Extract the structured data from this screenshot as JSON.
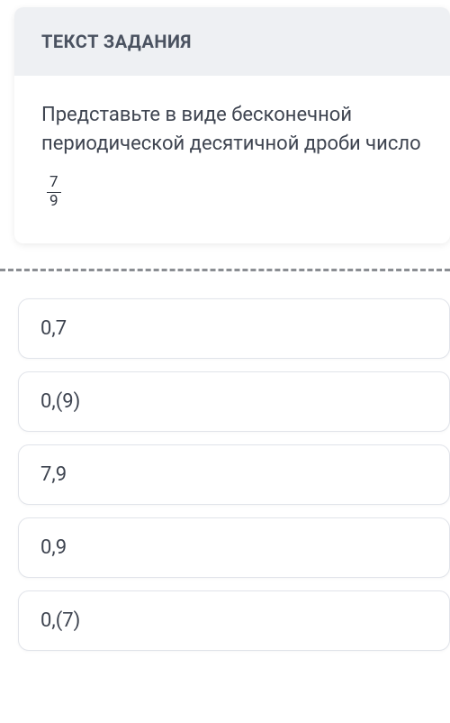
{
  "header": {
    "title": "ТЕКСТ ЗАДАНИЯ"
  },
  "prompt": {
    "text": "Представьте в виде бесконечной периодической десятичной дроби число",
    "fraction": {
      "numerator": "7",
      "denominator": "9"
    }
  },
  "options": [
    {
      "label": "0,7"
    },
    {
      "label": "0,(9)"
    },
    {
      "label": "7,9"
    },
    {
      "label": "0,9"
    },
    {
      "label": "0,(7)"
    }
  ]
}
